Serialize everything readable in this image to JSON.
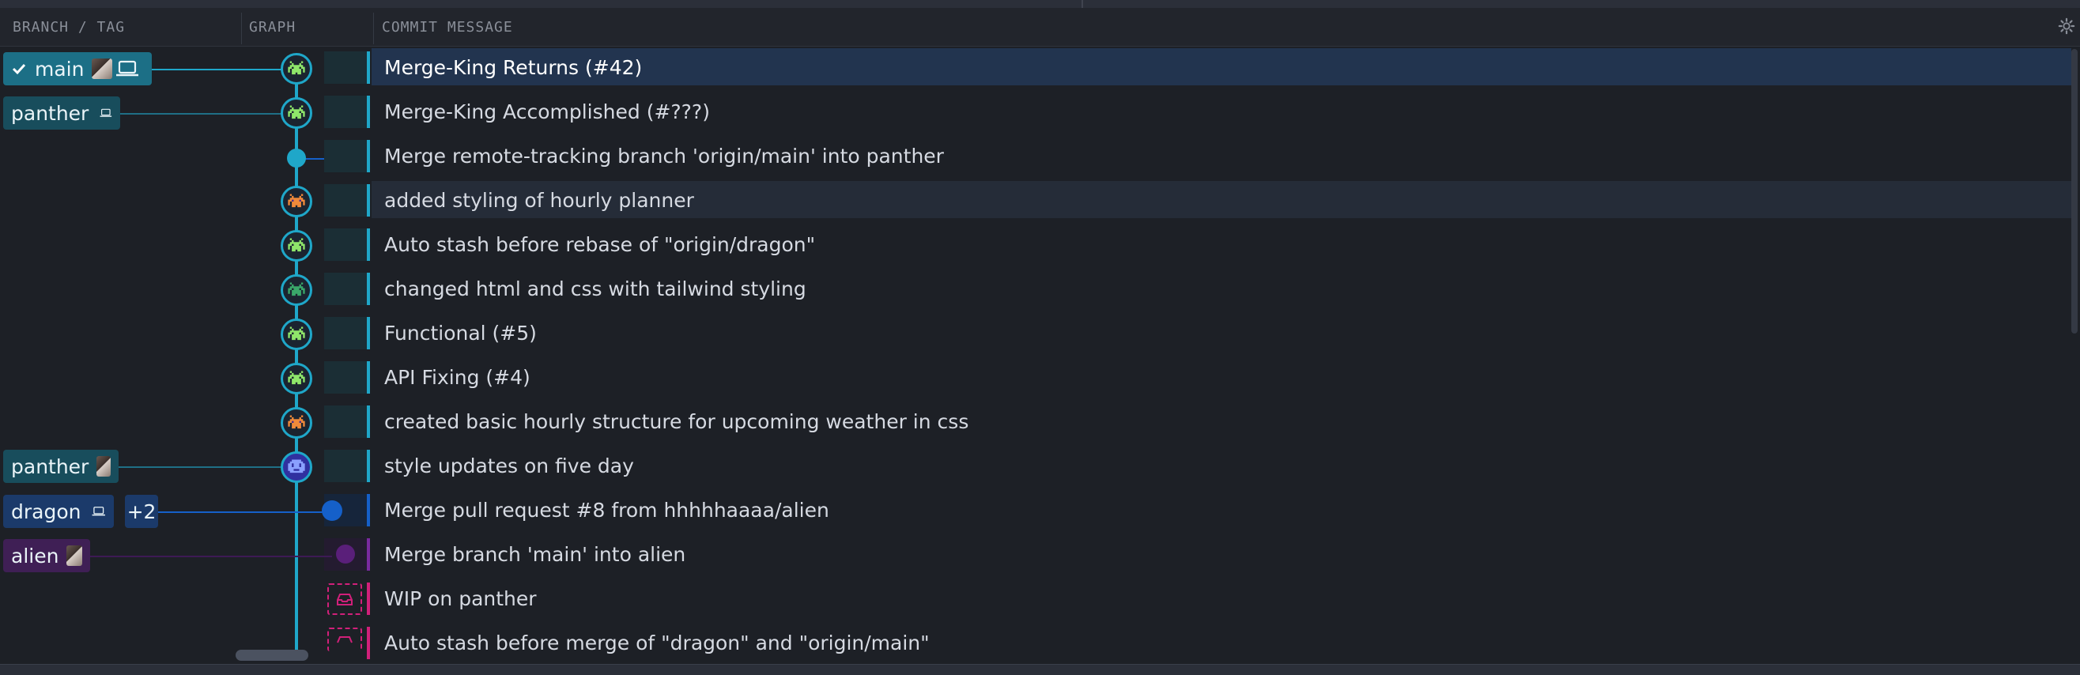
{
  "header": {
    "col_branch": "BRANCH / TAG",
    "col_graph": "GRAPH",
    "col_message": "COMMIT MESSAGE",
    "settings_icon": "gear-icon"
  },
  "commits": [
    {
      "message": "Merge-King Returns (#42)",
      "state": "selected"
    },
    {
      "message": "Merge-King Accomplished (#???)"
    },
    {
      "message": "Merge remote-tracking branch 'origin/main' into panther"
    },
    {
      "message": "added styling of hourly planner",
      "state": "hover"
    },
    {
      "message": "Auto stash before rebase of \"origin/dragon\""
    },
    {
      "message": "changed html and css with tailwind styling"
    },
    {
      "message": "Functional (#5)"
    },
    {
      "message": "API Fixing (#4)"
    },
    {
      "message": "created basic hourly structure for upcoming weather in css"
    },
    {
      "message": "style updates on five day"
    },
    {
      "message": "Merge pull request #8 from hhhhhaaaa/alien"
    },
    {
      "message": "Merge branch 'main' into alien"
    },
    {
      "message": "WIP on panther"
    },
    {
      "message": "Auto stash before merge of \"dragon\" and \"origin/main\""
    }
  ],
  "branches": {
    "main": {
      "label": "main",
      "checked": true,
      "icons": [
        "check-icon",
        "avatar",
        "laptop-icon"
      ],
      "color": "#1c6f86"
    },
    "panther_local": {
      "label": "panther",
      "icons": [
        "laptop-icon"
      ],
      "color": "#184d5c"
    },
    "panther_remote": {
      "label": "panther",
      "icons": [
        "avatar"
      ],
      "color": "#184d5c"
    },
    "dragon": {
      "label": "dragon",
      "icons": [
        "laptop-icon"
      ],
      "extra": "+2",
      "color": "#1b3a6a"
    },
    "alien": {
      "label": "alien",
      "icons": [
        "avatar"
      ],
      "color": "#3f1f55"
    }
  },
  "colors": {
    "background": "#1d2026",
    "graph_line": "#1fa7c9",
    "dragon_line": "#1560c9",
    "alien_line": "#6a1f8c",
    "wip_line": "#d1207a",
    "selected_row": "#22344f"
  }
}
